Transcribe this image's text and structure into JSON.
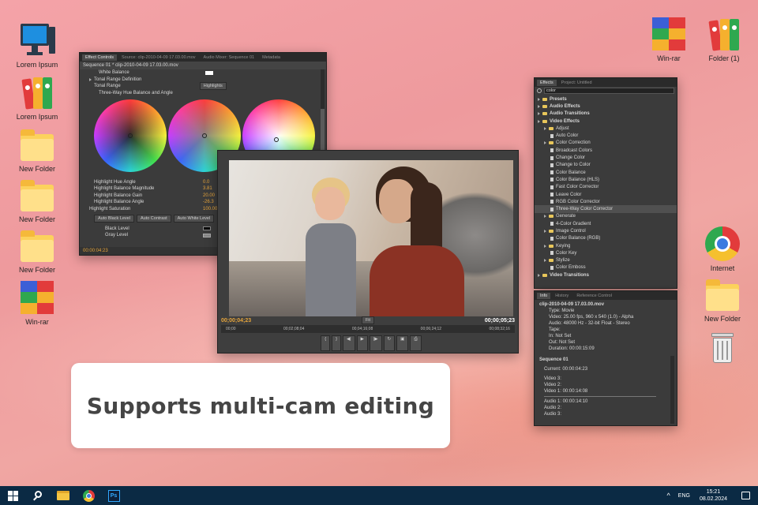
{
  "desktop": {
    "left_icons": [
      {
        "label": "Lorem Ipsum",
        "icon": "computer-icon"
      },
      {
        "label": "Lorem Ipsum",
        "icon": "binders-icon"
      },
      {
        "label": "New Folder",
        "icon": "folder-icon"
      },
      {
        "label": "New Folder",
        "icon": "folder-icon"
      },
      {
        "label": "New Folder",
        "icon": "folder-icon"
      },
      {
        "label": "Win-rar",
        "icon": "winrar-icon"
      }
    ],
    "right_icons": [
      {
        "label": "Win-rar",
        "icon": "winrar-icon"
      },
      {
        "label": "Folder (1)",
        "icon": "binders-icon"
      },
      {
        "label": "Internet",
        "icon": "chrome-icon"
      },
      {
        "label": "New Folder",
        "icon": "folder-icon"
      },
      {
        "label": "",
        "icon": "recycle-bin-icon"
      }
    ]
  },
  "effect_controls": {
    "tabs": [
      "Effect Controls",
      "Source: clip-2010-04-09 17.03.00.mov",
      "Audio Mixer: Sequence 01",
      "Metadata"
    ],
    "sequence_label": "Sequence 01 * clip-2010-04-09 17.03.00.mov",
    "rows_top": [
      "White Balance",
      "Tonal Range Definition",
      "Tonal Range",
      "Three-Way Hue Balance and Angle"
    ],
    "tonal_range_value": "Highlights",
    "rows_bottom": [
      {
        "label": "Highlight Hue Angle",
        "value": "0.0"
      },
      {
        "label": "Highlight Balance Magnitude",
        "value": "3.81"
      },
      {
        "label": "Highlight Balance Gain",
        "value": "20.00"
      },
      {
        "label": "Highlight Balance Angle",
        "value": "-26.3"
      },
      {
        "label": "Highlight Saturation",
        "value": "100.00"
      }
    ],
    "buttons": [
      "Auto Black Level",
      "Auto Contrast",
      "Auto White Level"
    ],
    "rows_levels": [
      "Black Level",
      "Gray Level"
    ],
    "timecode": "00:00:04:23"
  },
  "program_monitor": {
    "timecode_current": "00;00;04;23",
    "zoom": "Fit",
    "timecode_total": "00;00;05;23",
    "ruler": [
      "00;00",
      "00;02;08;04",
      "00;04;16;08",
      "00;06;24;12",
      "00;08;32;16"
    ]
  },
  "effects_panel": {
    "tabs": [
      "Effects",
      "Project: Untitled"
    ],
    "search": "color",
    "tree": [
      {
        "label": "Presets",
        "level": 0,
        "type": "folder"
      },
      {
        "label": "Audio Effects",
        "level": 0,
        "type": "folder"
      },
      {
        "label": "Audio Transitions",
        "level": 0,
        "type": "folder"
      },
      {
        "label": "Video Effects",
        "level": 0,
        "type": "folder"
      },
      {
        "label": "Adjust",
        "level": 1,
        "type": "folder"
      },
      {
        "label": "Auto Color",
        "level": 2,
        "type": "file"
      },
      {
        "label": "Color Correction",
        "level": 1,
        "type": "folder"
      },
      {
        "label": "Broadcast Colors",
        "level": 2,
        "type": "file"
      },
      {
        "label": "Change Color",
        "level": 2,
        "type": "file"
      },
      {
        "label": "Change to Color",
        "level": 2,
        "type": "file"
      },
      {
        "label": "Color Balance",
        "level": 2,
        "type": "file"
      },
      {
        "label": "Color Balance (HLS)",
        "level": 2,
        "type": "file"
      },
      {
        "label": "Fast Color Corrector",
        "level": 2,
        "type": "file"
      },
      {
        "label": "Leave Color",
        "level": 2,
        "type": "file"
      },
      {
        "label": "RGB Color Corrector",
        "level": 2,
        "type": "file"
      },
      {
        "label": "Three-Way Color Corrector",
        "level": 2,
        "type": "file"
      },
      {
        "label": "Generate",
        "level": 1,
        "type": "folder"
      },
      {
        "label": "4-Color Gradient",
        "level": 2,
        "type": "file"
      },
      {
        "label": "Image Control",
        "level": 1,
        "type": "folder"
      },
      {
        "label": "Color Balance (RGB)",
        "level": 2,
        "type": "file"
      },
      {
        "label": "Keying",
        "level": 1,
        "type": "folder"
      },
      {
        "label": "Color Key",
        "level": 2,
        "type": "file"
      },
      {
        "label": "Stylize",
        "level": 1,
        "type": "folder"
      },
      {
        "label": "Color Emboss",
        "level": 2,
        "type": "file"
      },
      {
        "label": "Video Transitions",
        "level": 0,
        "type": "folder"
      }
    ]
  },
  "info_panel": {
    "tabs": [
      "Info",
      "History",
      "Reference Control"
    ],
    "clip": "clip-2010-04-09 17.03.00.mov",
    "details": [
      "Type: Movie",
      "Video: 25.00 fps, 960 x 540 (1.0) - Alpha",
      "Audio: 48000 Hz - 32-bit Float - Stereo",
      "Tape:",
      "In: Not Set",
      "Out: Not Set",
      "Duration: 00:00:15:09"
    ],
    "sequence": "Sequence 01",
    "current": "Current: 00:00:04:23",
    "video_tracks": [
      "Video 3:",
      "Video 2:",
      "Video 1: 00:00:14:08"
    ],
    "audio_tracks": [
      "Audio 1: 00:00:14:10",
      "Audio 2:",
      "Audio 3:"
    ]
  },
  "banner": {
    "text": "Supports multi-cam editing"
  },
  "taskbar": {
    "lang": "ENG",
    "time": "15:21",
    "date": "08.02.2024"
  },
  "colors": {
    "accent_orange": "#e5a43b",
    "taskbar": "#0b2a44",
    "panel": "#3b3b3b"
  }
}
